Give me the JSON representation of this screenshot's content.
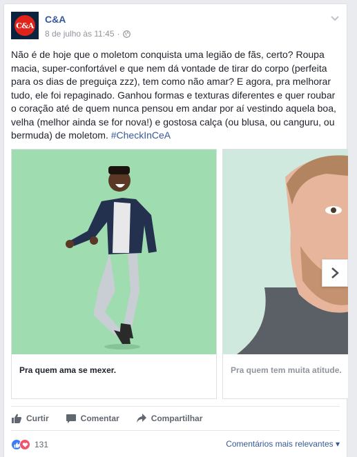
{
  "post": {
    "page_name": "C&A",
    "avatar_text": "C&A",
    "timestamp": "8 de julho às 11:45",
    "separator": "·",
    "privacy_icon": "globe-icon",
    "body": "Não é de hoje que o moletom conquista uma legião de fãs, certo? Roupa macia, super-confortável e que nem dá vontade de tirar do corpo (perfeita para os dias de preguiça zzz), tem como não amar? E agora, pra melhorar tudo, ele foi repaginado. Ganhou formas e texturas diferentes e quer roubar o coração até de quem nunca pensou em andar por aí vestindo aquela boa, velha (melhor ainda se for nova!) e gostosa calça (ou blusa, ou canguru, ou bermuda) de moletom.",
    "hashtag": "#CheckInCeA"
  },
  "carousel": {
    "cards": [
      {
        "caption": "Pra quem ama se mexer."
      },
      {
        "caption": "Pra quem tem muita atitude."
      }
    ]
  },
  "actions": {
    "like": "Curtir",
    "comment": "Comentar",
    "share": "Compartilhar"
  },
  "footer": {
    "reaction_count": "131",
    "sort_label": "Comentários mais relevantes"
  },
  "colors": {
    "link": "#365899",
    "brand_red": "#e2231a",
    "brand_navy": "#0c2340"
  }
}
